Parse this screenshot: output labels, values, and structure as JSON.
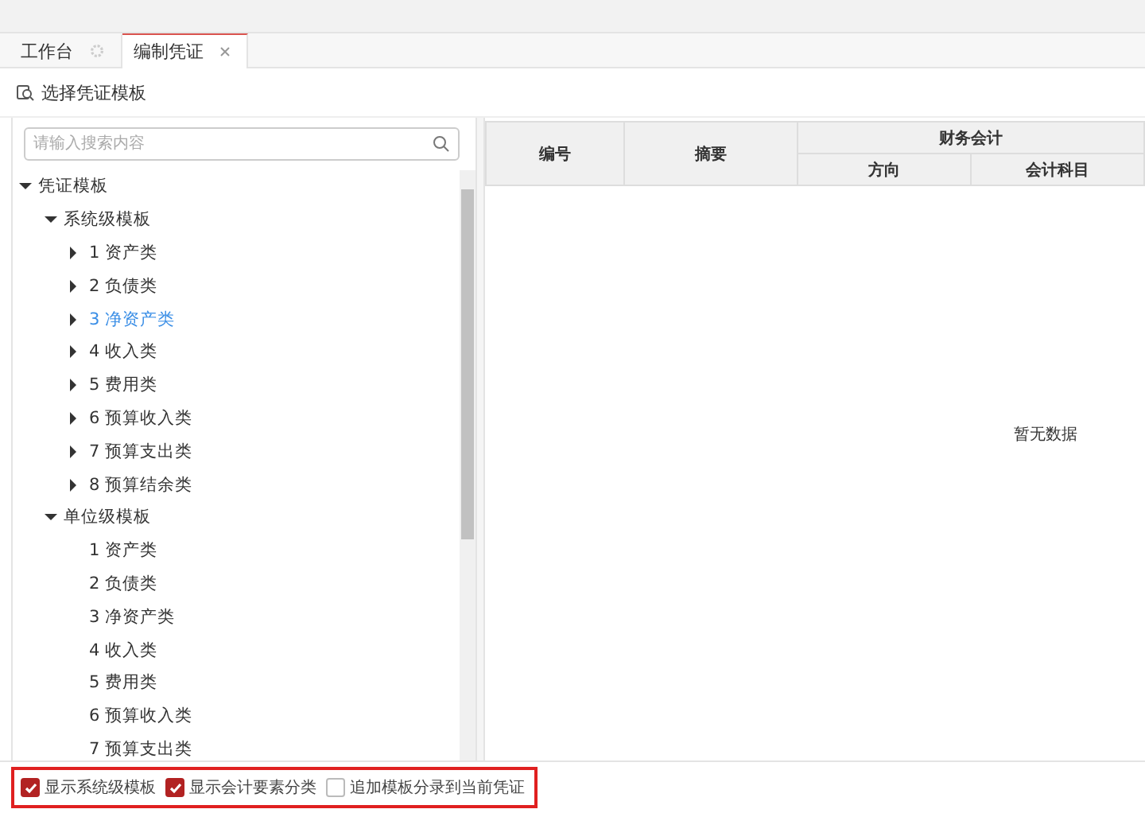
{
  "tabs": [
    {
      "label": "工作台",
      "selected": false
    },
    {
      "label": "编制凭证",
      "selected": true
    }
  ],
  "toolbar": {
    "label": "选择凭证模板"
  },
  "search": {
    "placeholder": "请输入搜索内容"
  },
  "tree": [
    {
      "label": "凭证模板",
      "kind": "group",
      "expanded": true,
      "selected": false,
      "children": [
        {
          "label": "系统级模板",
          "kind": "group",
          "expanded": true,
          "selected": false,
          "children": [
            {
              "label": "1 资产类",
              "kind": "group",
              "expanded": false,
              "selected": false
            },
            {
              "label": "2 负债类",
              "kind": "group",
              "expanded": false,
              "selected": false
            },
            {
              "label": "3 净资产类",
              "kind": "group",
              "expanded": false,
              "selected": true
            },
            {
              "label": "4 收入类",
              "kind": "group",
              "expanded": false,
              "selected": false
            },
            {
              "label": "5 费用类",
              "kind": "group",
              "expanded": false,
              "selected": false
            },
            {
              "label": "6 预算收入类",
              "kind": "group",
              "expanded": false,
              "selected": false
            },
            {
              "label": "7 预算支出类",
              "kind": "group",
              "expanded": false,
              "selected": false
            },
            {
              "label": "8 预算结余类",
              "kind": "group",
              "expanded": false,
              "selected": false
            }
          ]
        },
        {
          "label": "单位级模板",
          "kind": "group",
          "expanded": true,
          "selected": false,
          "children": [
            {
              "label": "1 资产类",
              "kind": "leaf",
              "selected": false
            },
            {
              "label": "2 负债类",
              "kind": "leaf",
              "selected": false
            },
            {
              "label": "3 净资产类",
              "kind": "leaf",
              "selected": false
            },
            {
              "label": "4 收入类",
              "kind": "leaf",
              "selected": false
            },
            {
              "label": "5 费用类",
              "kind": "leaf",
              "selected": false
            },
            {
              "label": "6 预算收入类",
              "kind": "leaf",
              "selected": false
            },
            {
              "label": "7 预算支出类",
              "kind": "leaf",
              "selected": false
            }
          ]
        }
      ]
    }
  ],
  "options": [
    {
      "label": "显示系统级模板",
      "checked": true
    },
    {
      "label": "显示会计要素分类",
      "checked": true
    },
    {
      "label": "追加模板分录到当前凭证",
      "checked": false
    }
  ],
  "table": {
    "columns": [
      {
        "label": "编号"
      },
      {
        "label": "摘要"
      }
    ],
    "group": {
      "label": "财务会计",
      "columns": [
        {
          "label": "方向"
        },
        {
          "label": "会计科目"
        }
      ]
    },
    "empty_text": "暂无数据"
  }
}
